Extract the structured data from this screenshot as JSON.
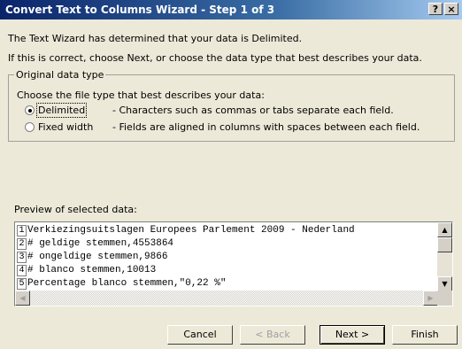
{
  "window": {
    "title": "Convert Text to Columns Wizard - Step 1 of 3",
    "help_label": "?",
    "close_label": "×"
  },
  "intro": {
    "line1": "The Text Wizard has determined that your data is Delimited.",
    "line2": "If this is correct, choose Next, or choose the data type that best describes your data."
  },
  "group": {
    "legend": "Original data type",
    "prompt": "Choose the file type that best describes your data:",
    "options": [
      {
        "label": "Delimited",
        "description": "- Characters such as commas or tabs separate each field.",
        "selected": true
      },
      {
        "label": "Fixed width",
        "description": "- Fields are aligned in columns with spaces between each field.",
        "selected": false
      }
    ]
  },
  "preview": {
    "label": "Preview of selected data:",
    "rows": [
      {
        "num": "1",
        "text": "Verkiezingsuitslagen Europees Parlement 2009 - Nederland"
      },
      {
        "num": "2",
        "text": "# geldige stemmen,4553864"
      },
      {
        "num": "3",
        "text": "# ongeldige stemmen,9866"
      },
      {
        "num": "4",
        "text": "# blanco stemmen,10013"
      },
      {
        "num": "5",
        "text": "Percentage blanco stemmen,\"0,22 %\""
      }
    ]
  },
  "buttons": {
    "cancel": "Cancel",
    "back": "< Back",
    "next": "Next >",
    "finish": "Finish"
  }
}
